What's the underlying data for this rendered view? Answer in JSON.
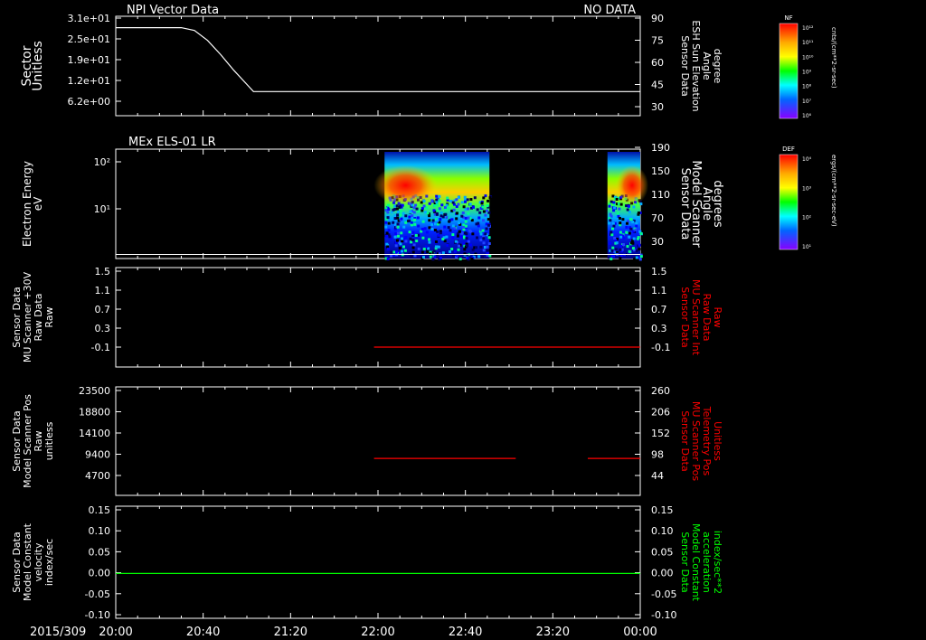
{
  "header": {
    "title": "NPI Vector Data",
    "status": "NO DATA"
  },
  "footer": {
    "date_label": "2015/309"
  },
  "time_axis": {
    "ticks": [
      "20:00",
      "20:40",
      "21:20",
      "22:00",
      "22:40",
      "23:20",
      "00:00"
    ]
  },
  "colors": {
    "axis": "#ffffff",
    "trace_white": "#ffffff",
    "trace_red": "#ff0000",
    "trace_green": "#00ff00",
    "background": "#000000"
  },
  "colorbars": [
    {
      "title": "NF",
      "unit_label": "cnts/(cm**2-sr-sec)",
      "ticks": [
        "10¹²",
        "10¹¹",
        "10¹⁰",
        "10⁹",
        "10⁸",
        "10⁷",
        "10⁶"
      ]
    },
    {
      "title": "DEF",
      "unit_label": "ergs/(cm**2-sr-sec-eV)",
      "ticks": [
        "10⁴",
        "10³",
        "10²",
        "10¹"
      ]
    }
  ],
  "chart_data": [
    {
      "type": "line",
      "title": "",
      "ylabel_left": [
        "Sector",
        "Unitless"
      ],
      "ylabel_right": [
        "Sensor Data",
        "ESH Sun Elevation",
        "Angle",
        "degree"
      ],
      "yticks_left": [
        "3.1e+01",
        "2.5e+01",
        "1.9e+01",
        "1.2e+01",
        "6.2e+00"
      ],
      "yticks_right": [
        "90",
        "75",
        "60",
        "45",
        "30"
      ],
      "ylim_right": [
        20,
        90
      ],
      "series": [
        {
          "color": "#ffffff",
          "x_hours": [
            0,
            0.5,
            0.6,
            0.7,
            0.8,
            0.9,
            1.0,
            1.05,
            2.0,
            3.0,
            4.0
          ],
          "y": [
            82,
            82,
            80,
            73,
            63,
            52,
            42,
            37,
            37,
            37,
            37
          ]
        }
      ]
    },
    {
      "type": "heatmap",
      "title": "MEx ELS-01 LR",
      "ylabel_left": [
        "Electron Energy",
        "eV"
      ],
      "ylabel_right": [
        "Sensor Data",
        "Model Scanner",
        "Angle",
        "degrees"
      ],
      "yticks_left": [
        "10²",
        "10¹"
      ],
      "yticks_right": [
        "190",
        "150",
        "110",
        "70",
        "30"
      ],
      "ylim_right": [
        0,
        190
      ],
      "data_blocks_hours": [
        [
          2.05,
          2.85
        ],
        [
          3.75,
          4.0
        ]
      ],
      "line": {
        "color": "#ffffff",
        "value_degrees": 7
      }
    },
    {
      "type": "line",
      "title": "",
      "ylabel_left": [
        "Sensor Data",
        "MU Scanner +30V",
        "Raw Data",
        "Raw"
      ],
      "ylabel_right": [
        "Sensor Data",
        "MU Scanner Int",
        "Raw Data",
        "Raw"
      ],
      "yticks_left": [
        "1.5",
        "1.1",
        "0.7",
        "0.3",
        "-0.1"
      ],
      "yticks_right": [
        "1.5",
        "1.1",
        "0.7",
        "0.3",
        "-0.1"
      ],
      "ylim": [
        -0.3,
        1.5
      ],
      "series": [
        {
          "color": "#ff0000",
          "x_hours": [
            1.97,
            4.0
          ],
          "y": [
            0.06,
            0.06
          ]
        }
      ]
    },
    {
      "type": "line",
      "title": "",
      "ylabel_left": [
        "Sensor Data",
        "Model Scanner Pos",
        "Raw",
        "unitless"
      ],
      "ylabel_right": [
        "Sensor Data",
        "MU Scanner Pos",
        "Telemetry Pos",
        "Unitless"
      ],
      "yticks_left": [
        "23500",
        "18800",
        "14100",
        "9400",
        "4700"
      ],
      "yticks_right": [
        "260",
        "206",
        "152",
        "98",
        "44"
      ],
      "ylim": [
        0,
        23500
      ],
      "series": [
        {
          "color": "#ff0000",
          "x_hours": [
            1.97,
            3.05
          ],
          "y": [
            8000,
            8000
          ]
        },
        {
          "color": "#ff0000",
          "x_hours": [
            3.6,
            4.0
          ],
          "y": [
            8000,
            8000
          ]
        }
      ]
    },
    {
      "type": "line",
      "title": "",
      "ylabel_left": [
        "Sensor Data",
        "Model Constant",
        "velocity",
        "index/sec"
      ],
      "ylabel_right": [
        "Sensor Data",
        "Model Constant",
        "acceleration",
        "index/sec**2"
      ],
      "yticks_left": [
        "0.15",
        "0.10",
        "0.05",
        "0.00",
        "-0.05",
        "-0.10"
      ],
      "yticks_right": [
        "0.15",
        "0.10",
        "0.05",
        "0.00",
        "-0.05",
        "-0.10"
      ],
      "ylim": [
        -0.1,
        0.15
      ],
      "series": [
        {
          "color": "#00ff00",
          "x_hours": [
            0,
            4.0
          ],
          "y": [
            0,
            0
          ]
        }
      ]
    }
  ]
}
